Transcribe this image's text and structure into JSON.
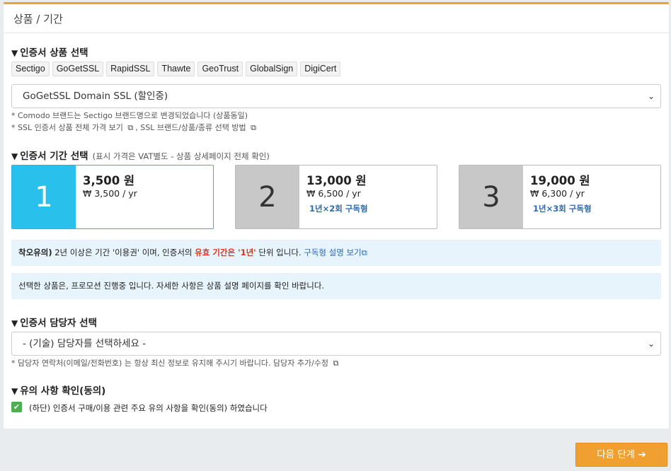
{
  "header": {
    "title": "상품 / 기간"
  },
  "product_section": {
    "title": "인증서 상품 선택",
    "brands": [
      "Sectigo",
      "GoGetSSL",
      "RapidSSL",
      "Thawte",
      "GeoTrust",
      "GlobalSign",
      "DigiCert"
    ],
    "selected_product": "GoGetSSL Domain SSL (할인중)",
    "note1": "* Comodo 브랜드는 Sectigo 브랜드명으로 변경되었습니다 (상품동일)",
    "note2_a": "* SSL 인증서 상품 전체 가격 보기",
    "note2_b": ", SSL 브랜드/상품/종류 선택 방법"
  },
  "period_section": {
    "title": "인증서 기간 선택",
    "subtitle": "(표시 가격은 VAT별도 - 상품 상세페이지 전체 확인)",
    "options": [
      {
        "years": "1",
        "price": "3,500 원",
        "per_year": "₩ 3,500 / yr",
        "sub": ""
      },
      {
        "years": "2",
        "price": "13,000 원",
        "per_year": "₩ 6,500 / yr",
        "sub": "1년×2회 구독형"
      },
      {
        "years": "3",
        "price": "19,000 원",
        "per_year": "₩ 6,300 / yr",
        "sub": "1년×3회 구독형"
      }
    ],
    "selected_index": 0
  },
  "notice1": {
    "bold": "착오유의)",
    "text1": " 2년 이상은 기간 '이용권' 이며, 인증서의 ",
    "red": "유효 기간은 '1년'",
    "text2": " 단위 입니다. ",
    "link": "구독형 설명 보기"
  },
  "notice2": "선택한 상품은, 프로모션 진행중 입니다. 자세한 사항은 상품 설명 페이지를 확인 바랍니다.",
  "contact_section": {
    "title": "인증서 담당자 선택",
    "placeholder": "- (기술) 담당자를 선택하세요 -",
    "note": "* 담당자 연락처(이메일/전화번호) 는 항상 최신 정보로 유지해 주시기 바랍니다. 담당자 추가/수정"
  },
  "agree_section": {
    "title": "유의 사항 확인(동의)",
    "checkbox_label": "(하단) 인증서 구매/이용 관련 주요 유의 사항을 확인(동의) 하였습니다",
    "checked": true
  },
  "next_button": "다음 단계",
  "colors": {
    "accent": "#f0a030",
    "active": "#29c0ec",
    "link": "#2a6ab3",
    "red": "#e0321e",
    "check": "#4caf50"
  }
}
